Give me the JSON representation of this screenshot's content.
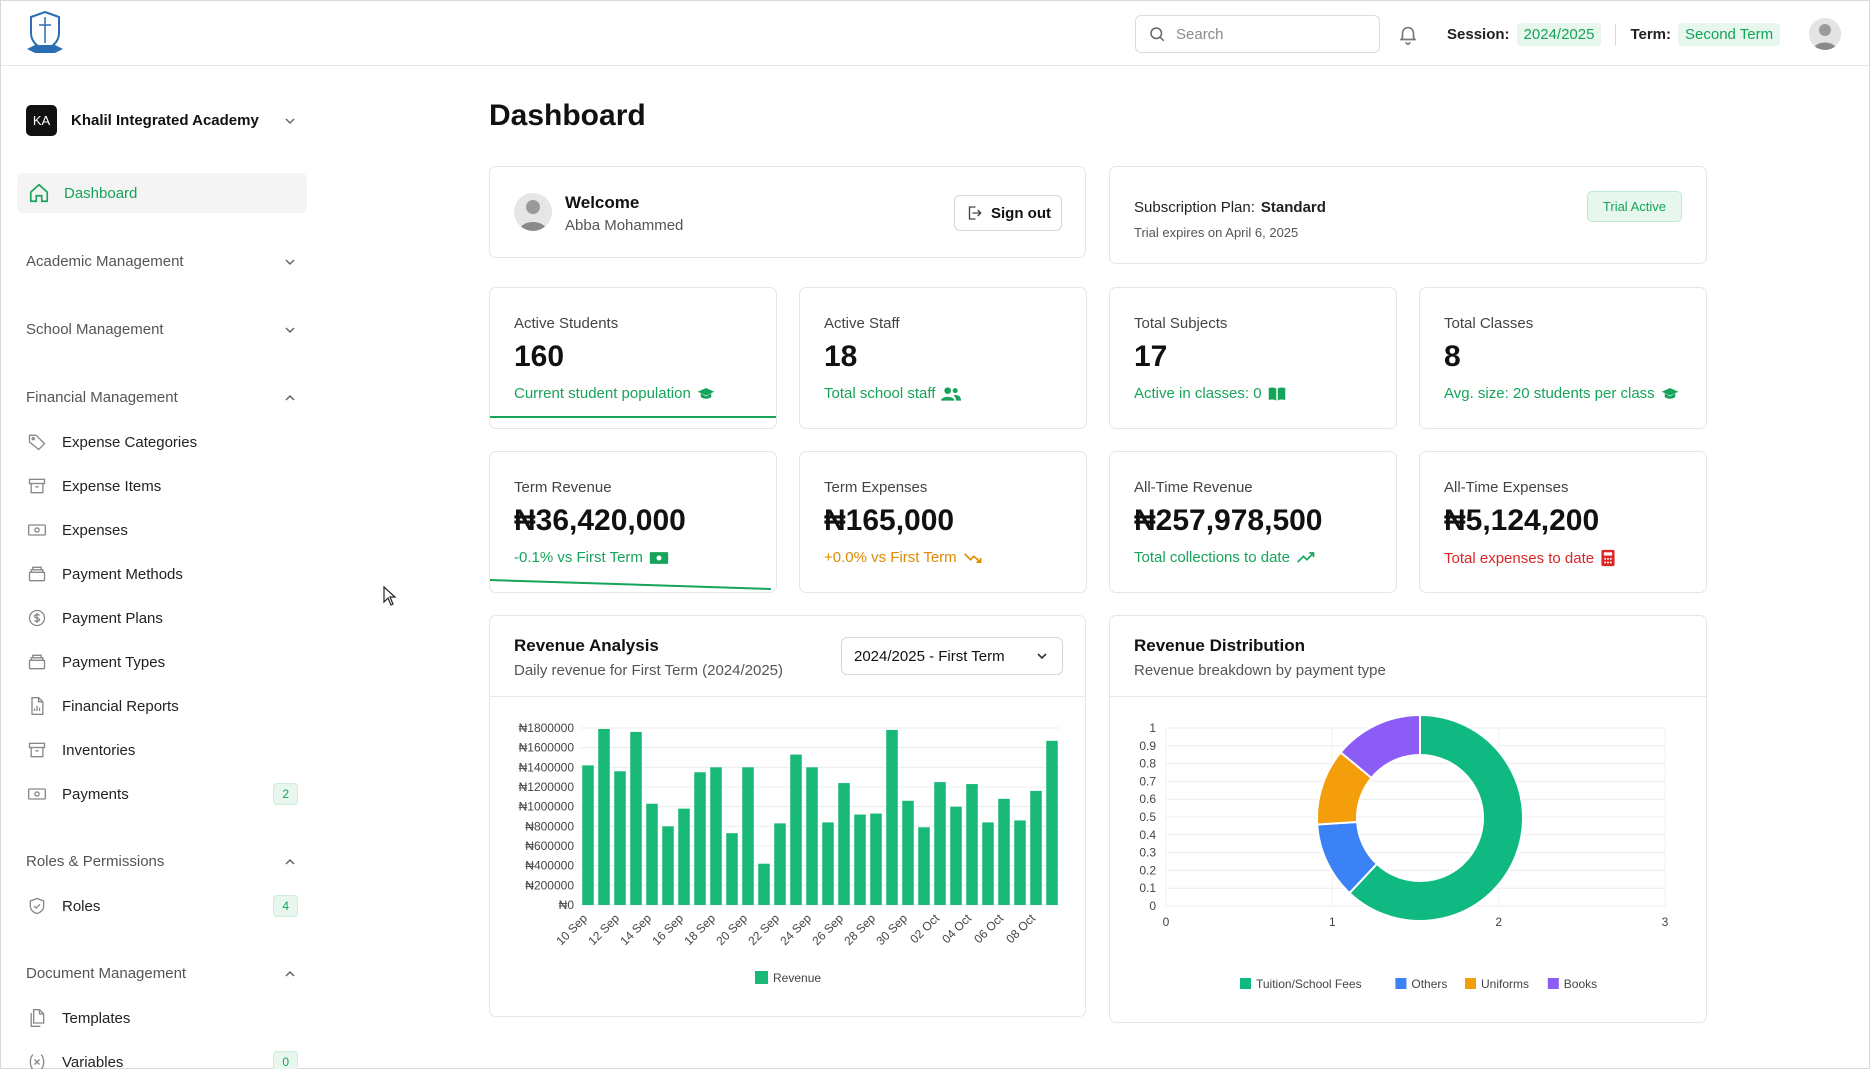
{
  "topbar": {
    "search_placeholder": "Search",
    "session_label": "Session:",
    "session_value": "2024/2025",
    "term_label": "Term:",
    "term_value": "Second Term"
  },
  "sidebar": {
    "school_badge": "KA",
    "school_name": "Khalil Integrated Academy",
    "dashboard": "Dashboard",
    "sections": {
      "academic": "Academic Management",
      "school": "School Management",
      "financial": "Financial Management",
      "roles": "Roles & Permissions",
      "documents": "Document Management"
    },
    "financial_items": [
      {
        "label": "Expense Categories",
        "icon": "tag-icon"
      },
      {
        "label": "Expense Items",
        "icon": "archive-icon"
      },
      {
        "label": "Expenses",
        "icon": "banknote-icon"
      },
      {
        "label": "Payment Methods",
        "icon": "layers-icon"
      },
      {
        "label": "Payment Plans",
        "icon": "dollar-circle-icon"
      },
      {
        "label": "Payment Types",
        "icon": "layers-icon"
      },
      {
        "label": "Financial Reports",
        "icon": "file-chart-icon"
      },
      {
        "label": "Inventories",
        "icon": "archive-icon"
      },
      {
        "label": "Payments",
        "icon": "banknote-icon",
        "count": "2"
      }
    ],
    "roles_items": [
      {
        "label": "Roles",
        "icon": "shield-check-icon",
        "count": "4"
      }
    ],
    "document_items": [
      {
        "label": "Templates",
        "icon": "files-icon"
      },
      {
        "label": "Variables",
        "icon": "variable-icon",
        "count": "0"
      }
    ]
  },
  "main": {
    "title": "Dashboard",
    "welcome": {
      "heading": "Welcome",
      "name": "Abba Mohammed",
      "signout": "Sign out"
    },
    "subscription": {
      "label": "Subscription Plan:",
      "plan": "Standard",
      "expiry": "Trial expires on April 6, 2025",
      "badge": "Trial Active"
    },
    "stats": [
      {
        "label": "Active Students",
        "value": "160",
        "note": "Current student population",
        "tone": "green"
      },
      {
        "label": "Active Staff",
        "value": "18",
        "note": "Total school staff",
        "tone": "green"
      },
      {
        "label": "Total Subjects",
        "value": "17",
        "note": "Active in classes: 0",
        "tone": "green"
      },
      {
        "label": "Total Classes",
        "value": "8",
        "note": "Avg. size: 20 students per class",
        "tone": "green"
      },
      {
        "label": "Term Revenue",
        "value": "₦36,420,000",
        "note": "-0.1% vs First Term",
        "tone": "green"
      },
      {
        "label": "Term Expenses",
        "value": "₦165,000",
        "note": "+0.0% vs First Term",
        "tone": "orange"
      },
      {
        "label": "All-Time Revenue",
        "value": "₦257,978,500",
        "note": "Total collections to date",
        "tone": "green"
      },
      {
        "label": "All-Time Expenses",
        "value": "₦5,124,200",
        "note": "Total expenses to date",
        "tone": "red"
      }
    ],
    "revenue_analysis": {
      "title": "Revenue Analysis",
      "subtitle": "Daily revenue for First Term (2024/2025)",
      "select_value": "2024/2025 - First Term"
    },
    "revenue_distribution": {
      "title": "Revenue Distribution",
      "subtitle": "Revenue breakdown by payment type"
    }
  },
  "colors": {
    "accent": "#16a35a",
    "bar": "#18b877",
    "tuition": "#10b981",
    "others": "#3b82f6",
    "uniforms": "#f59e0b",
    "books": "#8b5cf6"
  },
  "chart_data": [
    {
      "type": "bar",
      "yticks": [
        "₦0",
        "₦200000",
        "₦400000",
        "₦600000",
        "₦800000",
        "₦1000000",
        "₦1200000",
        "₦1400000",
        "₦1600000",
        "₦1800000"
      ],
      "ylim": [
        0,
        1800000
      ],
      "xticks": [
        "10 Sep",
        "12 Sep",
        "14 Sep",
        "16 Sep",
        "18 Sep",
        "20 Sep",
        "22 Sep",
        "24 Sep",
        "26 Sep",
        "28 Sep",
        "30 Sep",
        "02 Oct",
        "04 Oct",
        "06 Oct",
        "08 Oct"
      ],
      "series": [
        {
          "name": "Revenue",
          "values": [
            1420000,
            1790000,
            1360000,
            1760000,
            1030000,
            800000,
            980000,
            1350000,
            1400000,
            730000,
            1400000,
            420000,
            830000,
            1530000,
            1400000,
            840000,
            1240000,
            920000,
            930000,
            1780000,
            1060000,
            790000,
            1250000,
            1000000,
            1230000,
            840000,
            1080000,
            860000,
            1160000,
            1670000
          ]
        }
      ]
    },
    {
      "type": "pie",
      "yticks": [
        "0",
        "0.1",
        "0.2",
        "0.3",
        "0.4",
        "0.5",
        "0.6",
        "0.7",
        "0.8",
        "0.9",
        "1"
      ],
      "xticks": [
        "0",
        "1",
        "2",
        "3"
      ],
      "labels": [
        "Tuition/School Fees",
        "Others",
        "Uniforms",
        "Books"
      ],
      "values": [
        0.62,
        0.12,
        0.12,
        0.14
      ]
    }
  ]
}
